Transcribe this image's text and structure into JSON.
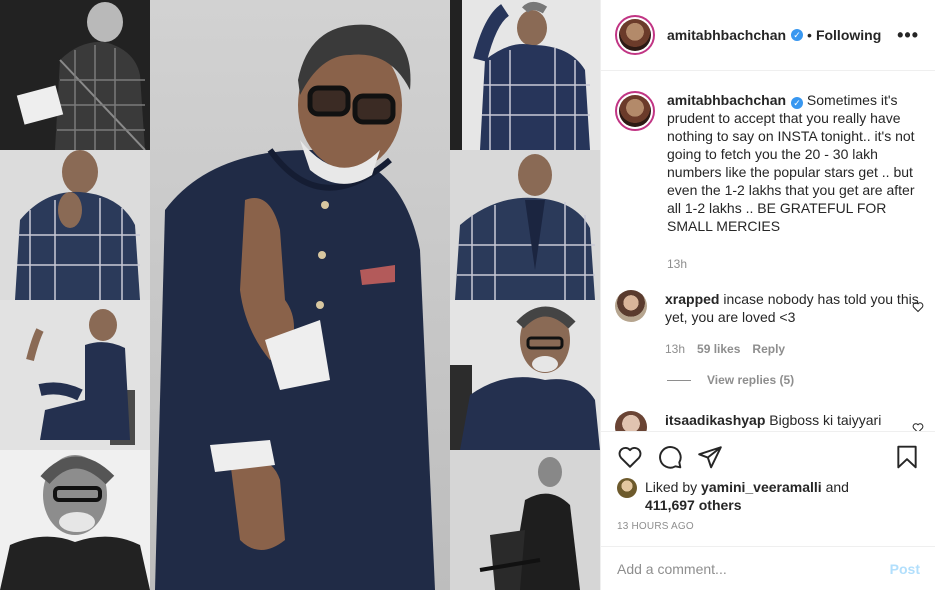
{
  "post": {
    "username": "amitabhbachchan",
    "verified_icon": "verified-badge-icon",
    "separator": "•",
    "follow_status": "Following",
    "more_label": "•••"
  },
  "caption": {
    "username": "amitabhbachchan",
    "text": "Sometimes it's prudent to accept that you really have nothing to say on INSTA tonight.. it's not going to fetch you the 20 - 30 lakh numbers like the popular stars get .. but even the 1-2 lakhs that you get are after all 1-2 lakhs .. BE GRATEFUL FOR SMALL MERCIES",
    "time": "13h"
  },
  "comments": [
    {
      "username": "xrapped",
      "text": "incase nobody has told you this yet, you are loved <3",
      "time": "13h",
      "likes": "59 likes",
      "reply_label": "Reply",
      "view_replies": "View replies (5)"
    },
    {
      "username": "itsaadikashyap",
      "text": "Bigboss ki taiyyari"
    }
  ],
  "likes": {
    "prefix": "Liked by",
    "user": "yamini_veeramalli",
    "and": "and",
    "others": "411,697 others"
  },
  "timestamp": "13 HOURS AGO",
  "add_comment": {
    "placeholder": "Add a comment...",
    "post_label": "Post"
  },
  "colors": {
    "accent": "#3897f0",
    "post_disabled": "#b2dffc",
    "muted": "#8e8e8e",
    "story_ring": "#c13584"
  },
  "icons": [
    "heart-icon",
    "comment-icon",
    "share-icon",
    "bookmark-icon",
    "more-options-icon"
  ]
}
